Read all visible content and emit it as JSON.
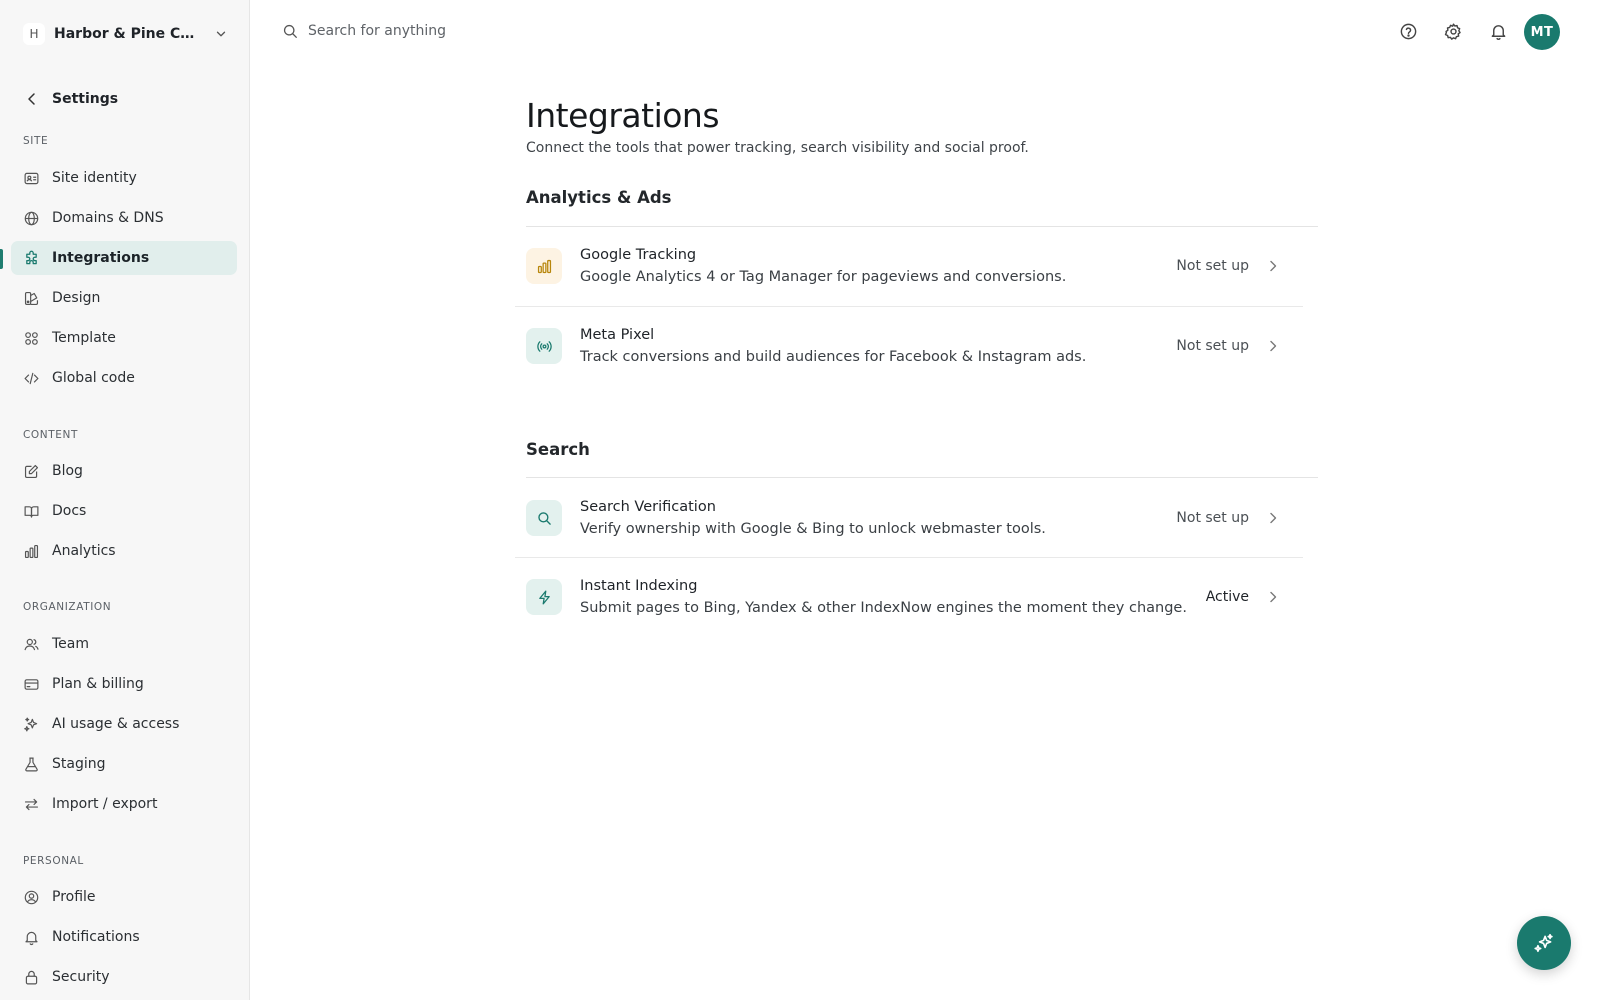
{
  "workspace": {
    "initial": "H",
    "name": "Harbor & Pine Coffee Co."
  },
  "sidebar": {
    "back_label": "Settings",
    "sections": [
      {
        "label": "SITE",
        "items": [
          {
            "label": "Site identity",
            "icon": "id-card-icon"
          },
          {
            "label": "Domains & DNS",
            "icon": "globe-icon"
          },
          {
            "label": "Integrations",
            "icon": "puzzle-icon",
            "active": true
          },
          {
            "label": "Design",
            "icon": "palette-icon"
          },
          {
            "label": "Template",
            "icon": "grid-icon"
          },
          {
            "label": "Global code",
            "icon": "code-icon"
          }
        ]
      },
      {
        "label": "CONTENT",
        "items": [
          {
            "label": "Blog",
            "icon": "pencil-icon"
          },
          {
            "label": "Docs",
            "icon": "book-icon"
          },
          {
            "label": "Analytics",
            "icon": "bar-chart-icon"
          }
        ]
      },
      {
        "label": "ORGANIZATION",
        "items": [
          {
            "label": "Team",
            "icon": "users-icon"
          },
          {
            "label": "Plan & billing",
            "icon": "credit-card-icon"
          },
          {
            "label": "AI usage & access",
            "icon": "sparkles-icon"
          },
          {
            "label": "Staging",
            "icon": "flask-icon"
          },
          {
            "label": "Import / export",
            "icon": "arrows-icon"
          }
        ]
      },
      {
        "label": "PERSONAL",
        "items": [
          {
            "label": "Profile",
            "icon": "user-circle-icon"
          },
          {
            "label": "Notifications",
            "icon": "bell-icon"
          },
          {
            "label": "Security",
            "icon": "lock-icon"
          }
        ]
      }
    ]
  },
  "topbar": {
    "search_placeholder": "Search for anything",
    "avatar_initials": "MT"
  },
  "main": {
    "title": "Integrations",
    "subtitle": "Connect the tools that power tracking, search visibility and social proof.",
    "groups": [
      {
        "title": "Analytics & Ads",
        "rows": [
          {
            "name": "Google Tracking",
            "desc": "Google Analytics 4 or Tag Manager for pageviews and conversions.",
            "status": "Not set up",
            "icon": "bar-chart-icon",
            "tint": "amber"
          },
          {
            "name": "Meta Pixel",
            "desc": "Track conversions and build audiences for Facebook & Instagram ads.",
            "status": "Not set up",
            "icon": "broadcast-icon",
            "tint": "teal"
          }
        ]
      },
      {
        "title": "Search",
        "rows": [
          {
            "name": "Search Verification",
            "desc": "Verify ownership with Google & Bing to unlock webmaster tools.",
            "status": "Not set up",
            "icon": "search-icon",
            "tint": "teal"
          },
          {
            "name": "Instant Indexing",
            "desc": "Submit pages to Bing, Yandex & other IndexNow engines the moment they change.",
            "status": "Active",
            "icon": "lightning-icon",
            "tint": "teal"
          }
        ]
      }
    ]
  },
  "colors": {
    "accent": "#1a7a6e",
    "active_bg": "#e1eeec",
    "amber_tint": "#fdf3e3",
    "teal_tint": "#e3f1ee"
  }
}
